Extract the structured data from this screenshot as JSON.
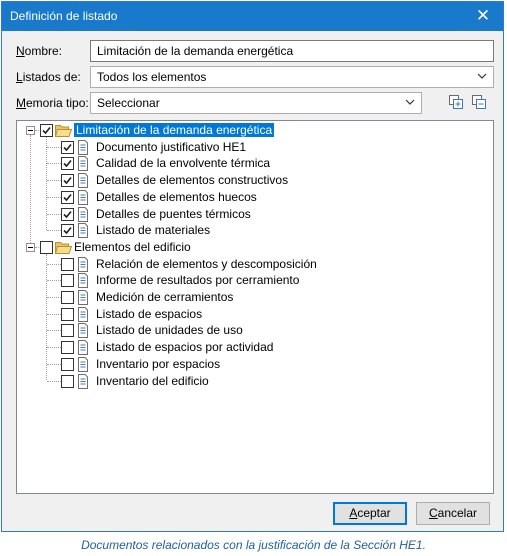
{
  "window": {
    "title": "Definición de listado",
    "close_glyph": "✕"
  },
  "form": {
    "nombre": {
      "label_u": "N",
      "label_rest": "ombre:",
      "value": "Limitación de la demanda energética"
    },
    "listados": {
      "label_u": "L",
      "label_rest": "istados de:",
      "value": "Todos los elementos"
    },
    "memoria": {
      "label_u": "M",
      "label_rest": "emoria tipo:",
      "value": "Seleccionar"
    }
  },
  "tree": {
    "groups": [
      {
        "label": "Limitación de la demanda energética",
        "checked": true,
        "items": [
          {
            "label": "Documento justificativo HE1",
            "checked": true
          },
          {
            "label": "Calidad de la envolvente térmica",
            "checked": true
          },
          {
            "label": "Detalles de elementos constructivos",
            "checked": true
          },
          {
            "label": "Detalles de elementos huecos",
            "checked": true
          },
          {
            "label": "Detalles de puentes térmicos",
            "checked": true
          },
          {
            "label": "Listado de materiales",
            "checked": true
          }
        ]
      },
      {
        "label": "Elementos del edificio",
        "checked": false,
        "items": [
          {
            "label": "Relación de elementos y descomposición",
            "checked": false
          },
          {
            "label": "Informe de resultados por cerramiento",
            "checked": false
          },
          {
            "label": "Medición de cerramientos",
            "checked": false
          },
          {
            "label": "Listado de espacios",
            "checked": false
          },
          {
            "label": "Listado de unidades de uso",
            "checked": false
          },
          {
            "label": "Listado de espacios por actividad",
            "checked": false
          },
          {
            "label": "Inventario por espacios",
            "checked": false
          },
          {
            "label": "Inventario del edificio",
            "checked": false
          }
        ]
      }
    ]
  },
  "buttons": {
    "accept": {
      "label_u": "A",
      "label_rest": "ceptar"
    },
    "cancel": {
      "label_u": "C",
      "label_rest": "ancelar"
    }
  },
  "caption": "Documentos relacionados con la justificación de la Sección HE1.",
  "colors": {
    "titlebar": "#1979ca",
    "selection": "#0078d7",
    "caption": "#1f5f9f"
  },
  "icons": [
    "close-icon",
    "dropdown-arrow-icon",
    "expand-all-icon",
    "collapse-all-icon",
    "folder-open-icon",
    "document-icon",
    "checkmark-icon"
  ]
}
